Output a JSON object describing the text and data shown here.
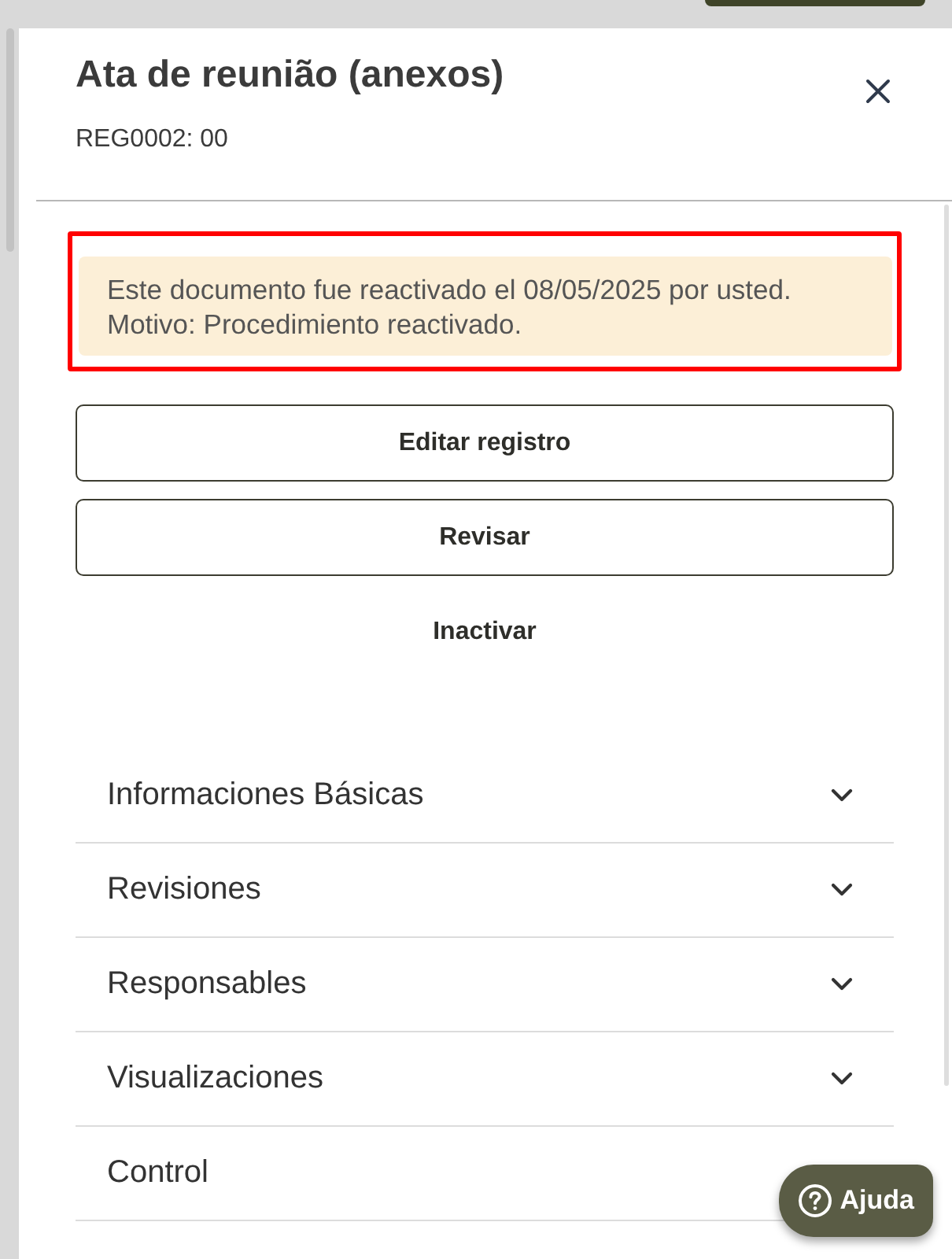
{
  "panel": {
    "title": "Ata de reunião (anexos)",
    "subtitle": "REG0002: 00"
  },
  "notice": {
    "highlighted": true,
    "lines": [
      "Este documento fue reactivado el 08/05/2025 por usted.",
      "Motivo: Procedimiento reactivado."
    ]
  },
  "actions": [
    {
      "label": "Editar registro",
      "kind": "outlined"
    },
    {
      "label": "Revisar",
      "kind": "outlined"
    },
    {
      "label": "Inactivar",
      "kind": "text"
    }
  ],
  "sections": [
    {
      "label": "Informaciones Básicas",
      "expanded": false
    },
    {
      "label": "Revisiones",
      "expanded": false
    },
    {
      "label": "Responsables",
      "expanded": false
    },
    {
      "label": "Visualizaciones",
      "expanded": false
    },
    {
      "label": "Control"
    }
  ],
  "help_button": {
    "label": "Ajuda"
  }
}
